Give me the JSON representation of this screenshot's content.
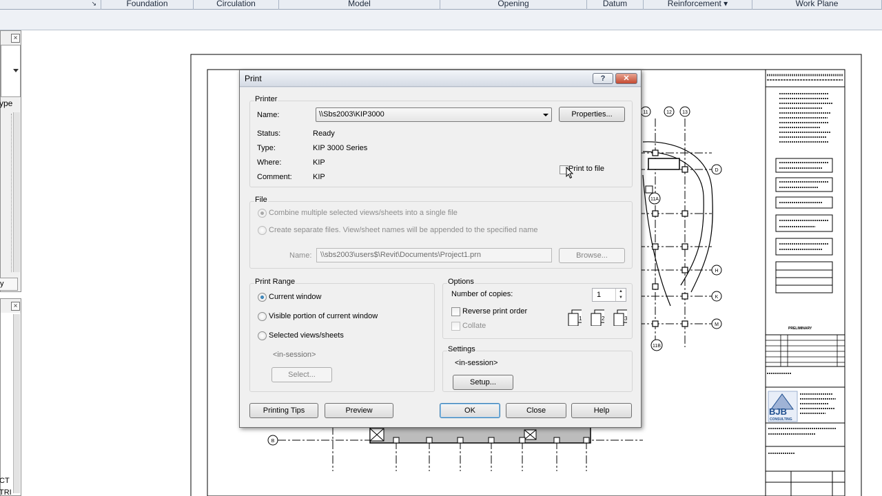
{
  "ribbon": {
    "panels": [
      "Foundation",
      "Circulation",
      "Model",
      "Opening",
      "Datum",
      "Reinforcement ▾",
      "Work Plane"
    ]
  },
  "left_panel": {
    "type_label": "ype",
    "bottom_items": [
      "CT",
      "TRI"
    ],
    "y_label": "y"
  },
  "print_dialog": {
    "title": "Print",
    "help_label": "?",
    "close_x": "✕",
    "printer": {
      "group_title": "Printer",
      "name_label": "Name:",
      "name_value": "\\\\Sbs2003\\KIP3000",
      "properties_button": "Properties...",
      "status_label": "Status:",
      "status_value": "Ready",
      "type_label": "Type:",
      "type_value": "KIP 3000 Series",
      "where_label": "Where:",
      "where_value": "KIP",
      "comment_label": "Comment:",
      "comment_value": "KIP",
      "print_to_file_label": "Print to file",
      "print_to_file_checked": false
    },
    "file": {
      "group_title": "File",
      "combine_label": "Combine multiple selected views/sheets into a single file",
      "separate_label": "Create separate files. View/sheet names will be appended to the specified name",
      "selected": "combine",
      "name_label": "Name:",
      "name_value": "\\\\sbs2003\\users$\\Revit\\Documents\\Project1.prn",
      "browse_button": "Browse..."
    },
    "print_range": {
      "group_title": "Print Range",
      "options": [
        "Current window",
        "Visible portion of current window",
        "Selected views/sheets"
      ],
      "selected": "Current window",
      "in_session": "<in-session>",
      "select_button": "Select..."
    },
    "options": {
      "group_title": "Options",
      "copies_label": "Number of copies:",
      "copies_value": "1",
      "reverse_label": "Reverse print order",
      "reverse_checked": false,
      "collate_label": "Collate",
      "collate_checked": false,
      "collate_pages": [
        "1",
        "2",
        "3"
      ]
    },
    "settings": {
      "group_title": "Settings",
      "value": "<in-session>",
      "setup_button": "Setup..."
    },
    "buttons": {
      "printing_tips": "Printing Tips",
      "preview": "Preview",
      "ok": "OK",
      "close": "Close",
      "help": "Help"
    }
  },
  "sheet": {
    "grid_labels_top": [
      "11",
      "12",
      "13"
    ],
    "grid_labels_right": [
      "D",
      "H",
      "K",
      "M"
    ],
    "grid_labels_misc": [
      "11A",
      "11B",
      "B"
    ],
    "title_block": {
      "stamp": "PRELIMINARY",
      "logo": "BJB",
      "logo_sub": "CONSULTING"
    }
  },
  "colors": {
    "dialog_bg": "#f0f0f0",
    "titlebar": "#d5dbe5",
    "close_button": "#c44a32",
    "ribbon": "#e9edf3",
    "logo_blue": "#1f4f8f"
  }
}
